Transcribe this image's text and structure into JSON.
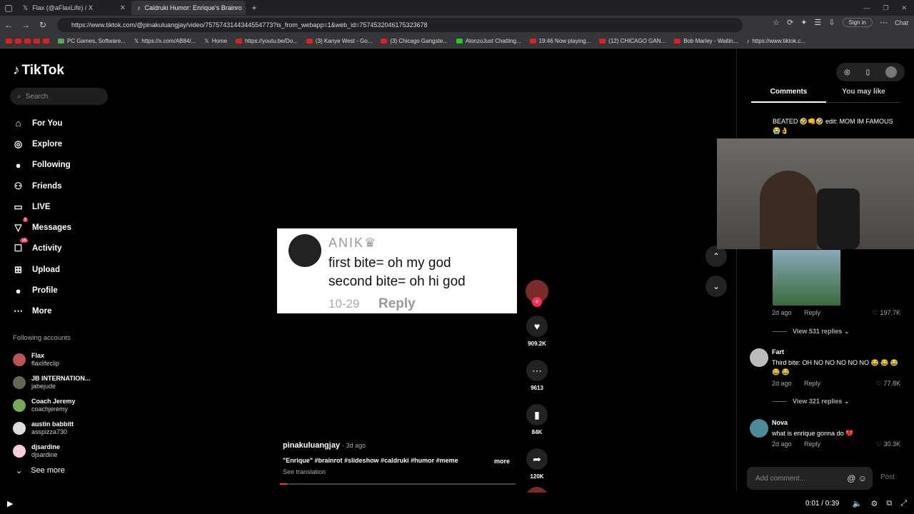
{
  "browser": {
    "tabs": [
      {
        "title": "Flax (@aFlaxLife) / X",
        "active": false
      },
      {
        "title": "Caldruki Humor: Enrique's Brainro",
        "active": true
      }
    ],
    "url": "https://www.tiktok.com/@pinakuluangjay/video/7575743144344554773?is_from_webapp=1&web_id=7574532046175323678",
    "sign_in": "Sign in",
    "chat": "Chat",
    "bookmarks": [
      "PC Games, Software...",
      "https://x.com/AB84/...",
      "Home",
      "https://youtu.be/Do...",
      "(3) Kanye West - Go...",
      "(3) Chicago Gangste...",
      "AlonzoJust Chatting...",
      "19:46 Now playing...",
      "(12) CHICAGO GAN...",
      "Bob Marley - Waitin...",
      "https://www.tiktok.c..."
    ]
  },
  "sidebar": {
    "logo": "TikTok",
    "search_placeholder": "Search",
    "nav": [
      {
        "label": "For You",
        "icon": "home-icon"
      },
      {
        "label": "Explore",
        "icon": "compass-icon"
      },
      {
        "label": "Following",
        "icon": "following-avatar-icon"
      },
      {
        "label": "Friends",
        "icon": "friends-icon"
      },
      {
        "label": "LIVE",
        "icon": "live-icon"
      },
      {
        "label": "Messages",
        "icon": "messages-icon",
        "badge": "3"
      },
      {
        "label": "Activity",
        "icon": "activity-icon",
        "badge": "15"
      },
      {
        "label": "Upload",
        "icon": "upload-icon"
      },
      {
        "label": "Profile",
        "icon": "profile-avatar-icon"
      },
      {
        "label": "More",
        "icon": "more-icon"
      }
    ],
    "following_title": "Following accounts",
    "following": [
      {
        "name": "Flax",
        "handle": "flaxlifeclip"
      },
      {
        "name": "JB INTERNATION...",
        "handle": "jabejude"
      },
      {
        "name": "Coach Jeremy",
        "handle": "coachjeremy"
      },
      {
        "name": "austin babbitt",
        "handle": "asspizza730"
      },
      {
        "name": "djsardine",
        "handle": "djsardine"
      }
    ],
    "see_more": "See more"
  },
  "video": {
    "card": {
      "username": "ANIK♛",
      "line1": "first bite= oh my god",
      "line2": "second bite= oh hi god",
      "date": "10-29",
      "reply": "Reply"
    },
    "likes": "909.2K",
    "comments": "9613",
    "saves": "84K",
    "shares": "120K",
    "author": "pinakuluangjay",
    "posted": "· 3d ago",
    "caption": "\"Enrique\" #brainrot #slideshow #caldruki #humor #meme",
    "more": "more",
    "see_translation": "See translation",
    "progress": 0.03
  },
  "right_panel": {
    "tabs": [
      "Comments",
      "You may like"
    ],
    "first_comment": "BEATED 🤣👊🤣 edit: MOM IM FAMOUS 😭👌",
    "comment_meta_1": {
      "ago": "2d ago",
      "reply": "Reply",
      "likes": "♡ 197.7K"
    },
    "view_replies_1": "View 531 replies ⌄",
    "comments": [
      {
        "name": "Fart",
        "text": "Third bite: OH NO NO NO NO NO 😂 😂 😂 😂 😂",
        "ago": "2d ago",
        "reply": "Reply",
        "likes": "♡ 77.8K"
      },
      {
        "name": "Nova",
        "text": "what is enrique gonna do 💔",
        "ago": "2d ago",
        "reply": "Reply",
        "likes": "♡ 30.3K"
      }
    ],
    "view_replies_2": "View 321 replies ⌄",
    "add_comment_placeholder": "Add comment...",
    "post": "Post"
  },
  "player": {
    "time": "0:01 / 0:39"
  }
}
